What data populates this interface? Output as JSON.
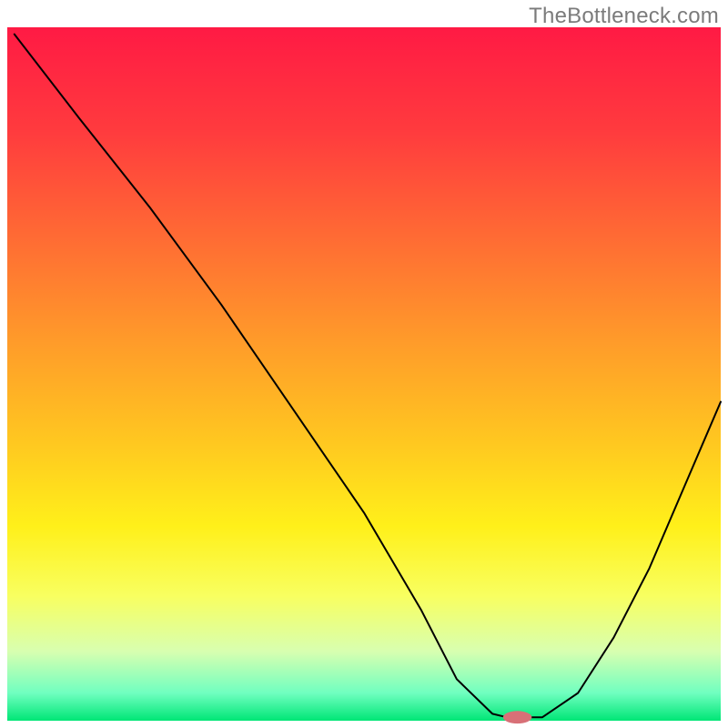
{
  "watermark": "TheBottleneck.com",
  "colors": {
    "gradient_stops": [
      {
        "offset": 0.0,
        "color": "#ff1a44"
      },
      {
        "offset": 0.15,
        "color": "#ff3b3e"
      },
      {
        "offset": 0.3,
        "color": "#ff6a34"
      },
      {
        "offset": 0.45,
        "color": "#ff9a2a"
      },
      {
        "offset": 0.6,
        "color": "#ffc820"
      },
      {
        "offset": 0.72,
        "color": "#fff01a"
      },
      {
        "offset": 0.82,
        "color": "#f8ff60"
      },
      {
        "offset": 0.9,
        "color": "#d8ffb0"
      },
      {
        "offset": 0.96,
        "color": "#70ffc0"
      },
      {
        "offset": 1.0,
        "color": "#00e676"
      }
    ],
    "curve": "#000000",
    "marker": "#d87077"
  },
  "chart_data": {
    "type": "line",
    "title": "",
    "xlabel": "",
    "ylabel": "",
    "xlim": [
      0,
      100
    ],
    "ylim": [
      0,
      100
    ],
    "grid": false,
    "legend": false,
    "series": [
      {
        "name": "bottleneck-curve",
        "x": [
          1,
          10,
          20,
          30,
          40,
          50,
          58,
          63,
          68,
          70,
          75,
          80,
          85,
          90,
          95,
          100
        ],
        "y": [
          99,
          87,
          74,
          60,
          45,
          30,
          16,
          6,
          1,
          0.5,
          0.5,
          4,
          12,
          22,
          34,
          46
        ]
      }
    ],
    "annotations": [
      {
        "name": "highlight-marker",
        "shape": "pill",
        "x": 71.5,
        "y": 0.5,
        "rx": 2.0,
        "ry": 0.9
      }
    ]
  }
}
